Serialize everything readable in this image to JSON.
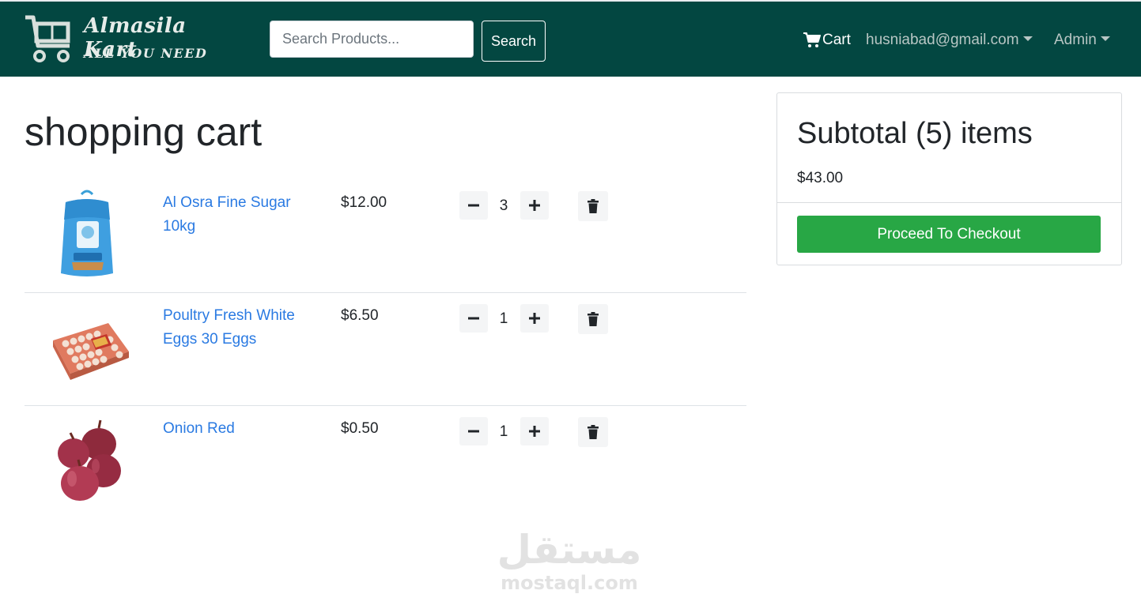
{
  "header": {
    "brand_name": "Almasila Kart",
    "brand_tagline": "ALL YOU NEED",
    "search_placeholder": "Search Products...",
    "search_button": "Search",
    "cart_label": "Cart",
    "user_email": "husniabad@gmail.com",
    "admin_label": "Admin",
    "colors": {
      "navbar": "#034741",
      "link": "#2a7ae2",
      "checkout": "#28a745"
    }
  },
  "page": {
    "title": "shopping cart"
  },
  "cart": {
    "items": [
      {
        "name": "Al Osra Fine Sugar 10kg",
        "price": "$12.00",
        "qty": "3",
        "image": "sugar-bag-image"
      },
      {
        "name": "Poultry Fresh White Eggs 30 Eggs",
        "price": "$6.50",
        "qty": "1",
        "image": "egg-tray-image"
      },
      {
        "name": "Onion Red",
        "price": "$0.50",
        "qty": "1",
        "image": "red-onions-image"
      }
    ]
  },
  "summary": {
    "title": "Subtotal (5) items",
    "amount": "$43.00",
    "checkout_button": "Proceed To Checkout"
  },
  "watermark": {
    "arabic": "مستقل",
    "latin": "mostaql.com"
  }
}
